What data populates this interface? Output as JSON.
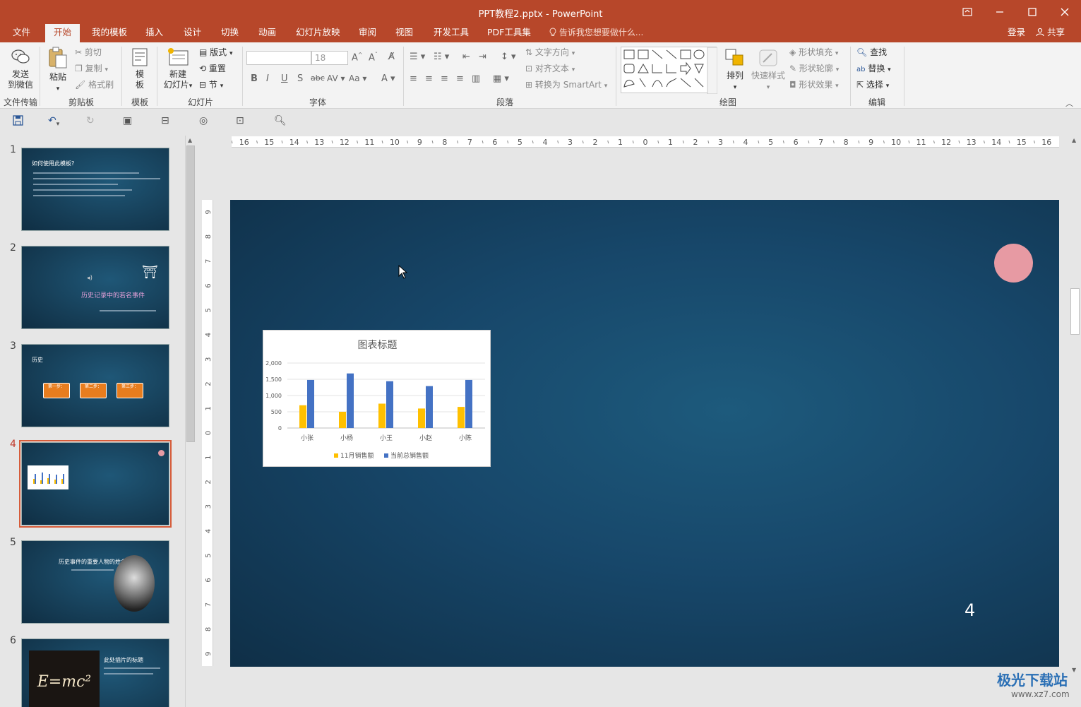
{
  "titlebar": {
    "title": "PPT教程2.pptx - PowerPoint",
    "controls": [
      "restore-ribbon",
      "minimize",
      "maximize",
      "close"
    ]
  },
  "tabs": [
    {
      "label": "文件"
    },
    {
      "label": "开始"
    },
    {
      "label": "我的模板"
    },
    {
      "label": "插入"
    },
    {
      "label": "设计"
    },
    {
      "label": "切换"
    },
    {
      "label": "动画"
    },
    {
      "label": "幻灯片放映"
    },
    {
      "label": "审阅"
    },
    {
      "label": "视图"
    },
    {
      "label": "开发工具"
    },
    {
      "label": "PDF工具集"
    }
  ],
  "active_tab": "开始",
  "tell_me": "告诉我您想要做什么...",
  "login": "登录",
  "share": "共享",
  "ribbon": {
    "send_wechat": "发送\n到微信",
    "send_wechat_l1": "发送",
    "send_wechat_l2": "到微信",
    "group_file_transfer": "文件传输",
    "paste": "粘贴",
    "cut": "剪切",
    "copy": "复制",
    "format_painter": "格式刷",
    "group_clipboard": "剪贴板",
    "template_l1": "模",
    "template_l2": "板",
    "group_template": "模板",
    "new_slide_l1": "新建",
    "new_slide_l2": "幻灯片",
    "layout": "版式",
    "reset": "重置",
    "section": "节",
    "group_slides": "幻灯片",
    "font_name": "",
    "font_size": "18",
    "group_font": "字体",
    "text_direction": "文字方向",
    "align_text": "对齐文本",
    "convert_smartart": "转换为 SmartArt",
    "group_paragraph": "段落",
    "arrange": "排列",
    "quick_styles": "快速样式",
    "shape_fill": "形状填充",
    "shape_outline": "形状轮廓",
    "shape_effects": "形状效果",
    "group_drawing": "绘图",
    "find": "查找",
    "replace": "替换",
    "select": "选择",
    "group_editing": "编辑"
  },
  "thumbnails": [
    {
      "num": "1",
      "title": "如何使用此模板?"
    },
    {
      "num": "2",
      "title": "历史记录中的若名事件"
    },
    {
      "num": "3",
      "title": "历史",
      "steps": [
        "第一步：",
        "第二步：",
        "第三步："
      ]
    },
    {
      "num": "4",
      "title": ""
    },
    {
      "num": "5",
      "title": "历史事件的重要人物的姓名"
    },
    {
      "num": "6",
      "title": "此处插片的标题"
    }
  ],
  "active_slide": "4",
  "slide": {
    "page_number": "4",
    "circle_color": "#e79aa3"
  },
  "ruler": {
    "h_labels": [
      "16",
      "15",
      "14",
      "13",
      "12",
      "11",
      "10",
      "9",
      "8",
      "7",
      "6",
      "5",
      "4",
      "3",
      "2",
      "1",
      "0",
      "1",
      "2",
      "3",
      "4",
      "5",
      "6",
      "7",
      "8",
      "9",
      "10",
      "11",
      "12",
      "13",
      "14",
      "15",
      "16"
    ],
    "v_labels": [
      "9",
      "8",
      "7",
      "6",
      "5",
      "4",
      "3",
      "2",
      "1",
      "0",
      "1",
      "2",
      "3",
      "4",
      "5",
      "6",
      "7",
      "8",
      "9"
    ]
  },
  "chart_data": {
    "type": "bar",
    "title": "图表标题",
    "categories": [
      "小张",
      "小杨",
      "小王",
      "小赵",
      "小陈"
    ],
    "series": [
      {
        "name": "11月销售额",
        "color": "#ffc000",
        "values": [
          700,
          500,
          750,
          600,
          650
        ]
      },
      {
        "name": "当前总销售额",
        "color": "#4472c4",
        "values": [
          1480,
          1680,
          1440,
          1290,
          1480
        ]
      }
    ],
    "yticks": [
      "0",
      "500",
      "1,000",
      "1,500",
      "2,000"
    ],
    "ylim": [
      0,
      2000
    ],
    "grid": true,
    "legend": "bottom"
  },
  "watermark": {
    "brand": "极光下载站",
    "url": "www.xz7.com"
  }
}
